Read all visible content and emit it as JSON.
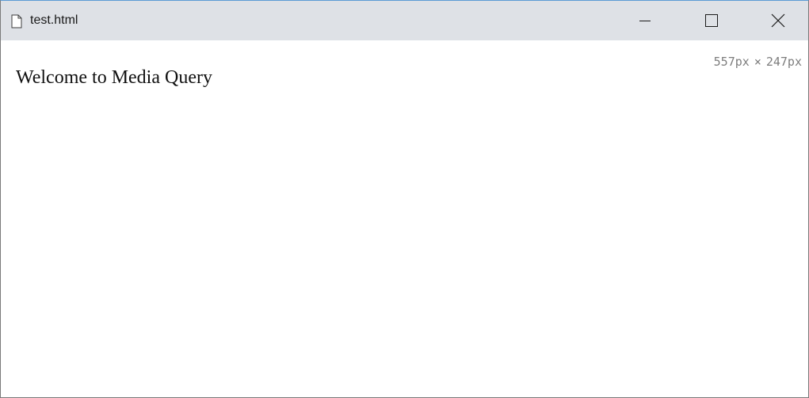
{
  "window": {
    "title": "test.html",
    "icon": "document-icon",
    "controls": {
      "minimize_icon": "minimize-icon",
      "maximize_icon": "maximize-icon",
      "close_icon": "close-icon"
    },
    "colors": {
      "titlebar": "#dee1e6",
      "accent_border": "#5b9bd5"
    }
  },
  "viewport": {
    "width_text": "557px",
    "separator": "×",
    "height_text": "247px"
  },
  "page": {
    "heading": "Welcome to Media Query"
  }
}
